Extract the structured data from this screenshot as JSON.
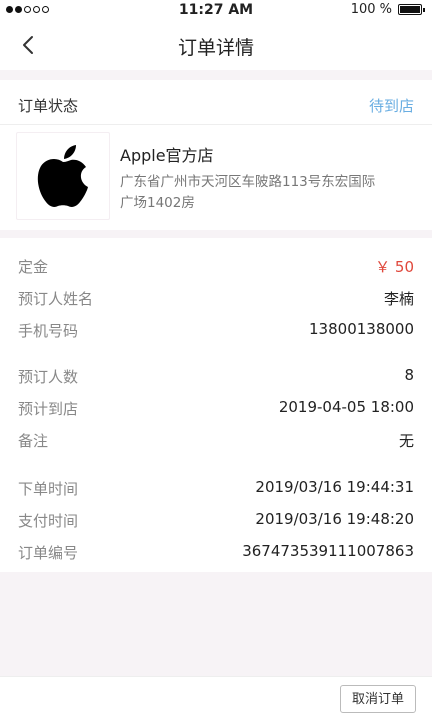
{
  "status_bar": {
    "time": "11:27 AM",
    "battery": "100 %",
    "signal_filled": 2,
    "signal_empty": 3
  },
  "nav": {
    "title": "订单详情",
    "back_icon": "chevron-left-icon"
  },
  "order_status": {
    "label": "订单状态",
    "value": "待到店",
    "value_color": "#6aaee2"
  },
  "store": {
    "logo_icon": "apple-logo-icon",
    "name": "Apple官方店",
    "address": "广东省广州市天河区车陂路113号东宏国际广场1402房"
  },
  "deposit": {
    "label": "定金",
    "value": "￥ 50",
    "value_color": "#e0483c"
  },
  "booking": [
    {
      "label": "预订人姓名",
      "value": "李楠"
    },
    {
      "label": "手机号码",
      "value": "13800138000"
    },
    {
      "label": "预订人数",
      "value": "8"
    },
    {
      "label": "预计到店",
      "value": "2019-04-05 18:00"
    },
    {
      "label": "备注",
      "value": "无"
    }
  ],
  "order_info": [
    {
      "label": "下单时间",
      "value": "2019/03/16 19:44:31"
    },
    {
      "label": "支付时间",
      "value": "2019/03/16 19:48:20"
    },
    {
      "label": "订单编号",
      "value": "367473539111007863"
    }
  ],
  "footer": {
    "cancel_label": "取消订单"
  }
}
